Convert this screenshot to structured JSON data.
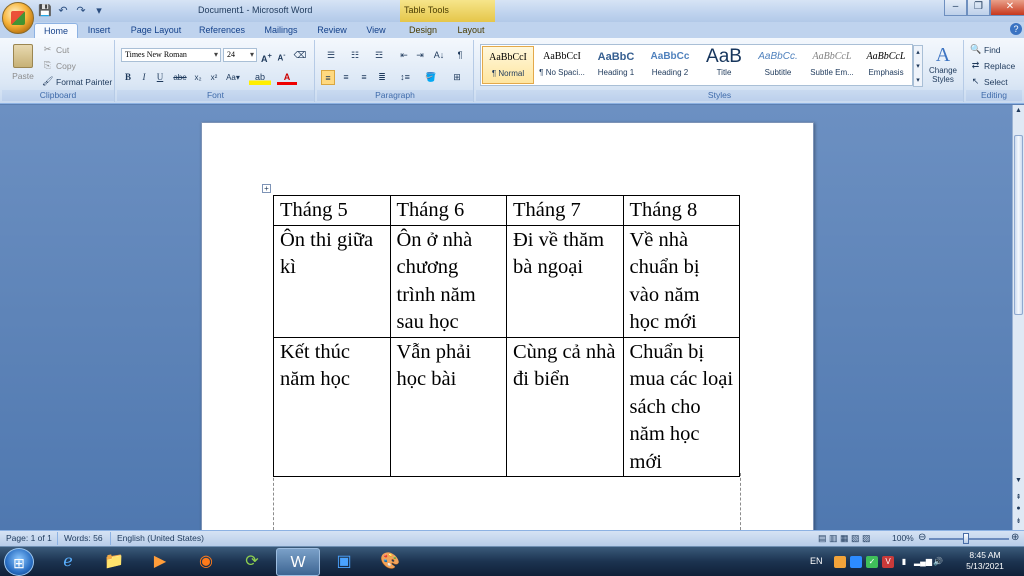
{
  "window": {
    "title": "Document1 - Microsoft Word",
    "contextual_tab_group": "Table Tools"
  },
  "tabs": [
    "Home",
    "Insert",
    "Page Layout",
    "References",
    "Mailings",
    "Review",
    "View",
    "Design",
    "Layout"
  ],
  "ribbon": {
    "clipboard": {
      "paste": "Paste",
      "cut": "Cut",
      "copy": "Copy",
      "format_painter": "Format Painter",
      "label": "Clipboard"
    },
    "font": {
      "name": "Times New Roman",
      "size": "24",
      "label": "Font"
    },
    "paragraph": {
      "label": "Paragraph"
    },
    "styles": {
      "label": "Styles",
      "items": [
        {
          "sample": "AaBbCcI",
          "name": "¶ Normal"
        },
        {
          "sample": "AaBbCcI",
          "name": "¶ No Spaci..."
        },
        {
          "sample": "AaBbC",
          "name": "Heading 1"
        },
        {
          "sample": "AaBbCc",
          "name": "Heading 2"
        },
        {
          "sample": "AaB",
          "name": "Title"
        },
        {
          "sample": "AaBbCc.",
          "name": "Subtitle"
        },
        {
          "sample": "AaBbCcL",
          "name": "Subtle Em..."
        },
        {
          "sample": "AaBbCcL",
          "name": "Emphasis"
        }
      ],
      "change_styles_1": "Change",
      "change_styles_2": "Styles"
    },
    "editing": {
      "find": "Find",
      "replace": "Replace",
      "select": "Select",
      "label": "Editing"
    }
  },
  "document_table": {
    "rows": [
      [
        "Tháng 5",
        "Tháng 6",
        "Tháng 7",
        "Tháng 8"
      ],
      [
        "Ôn thi giữa kì",
        "Ôn ở nhà chương trình năm sau học",
        "Đi về thăm bà ngoại",
        "Về nhà chuẩn bị vào năm học mới"
      ],
      [
        "Kết thúc năm học",
        "Vẫn phải học bài",
        "Cùng cả nhà đi biển",
        "Chuẩn bị mua các loại sách cho năm học mới"
      ]
    ]
  },
  "status": {
    "page": "Page: 1 of 1",
    "words": "Words: 56",
    "language": "English (United States)",
    "zoom": "100%"
  },
  "taskbar": {
    "language": "EN",
    "time": "8:45 AM",
    "date": "5/13/2021"
  }
}
